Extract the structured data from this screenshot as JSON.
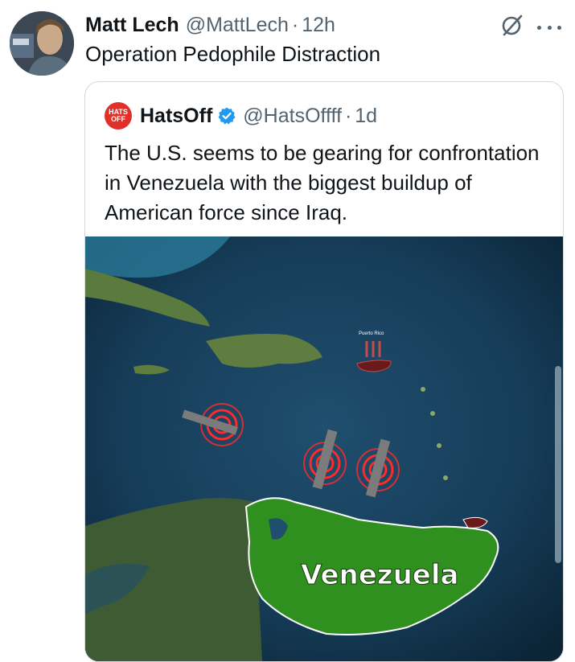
{
  "tweet": {
    "author_name": "Matt Lech",
    "author_handle": "@MattLech",
    "separator": "·",
    "time": "12h",
    "text": "Operation Pedophile Distraction"
  },
  "quoted_tweet": {
    "avatar_text_top": "HATS",
    "avatar_text_bottom": "OFF",
    "author_name": "HatsOff",
    "author_handle": "@HatsOffff",
    "separator": "·",
    "time": "1d",
    "text": "The U.S. seems to be gearing for confrontation in Venezuela with the biggest buildup of American force since Iraq.",
    "media": {
      "label_main": "Venezuela",
      "label_small": "Puerto Rico"
    }
  },
  "icons": {
    "avatar": "user-avatar",
    "grok": "grok-icon",
    "more": "more-options-icon",
    "verified": "verified-badge-icon"
  },
  "colors": {
    "accent_blue": "#1d9bf0",
    "ring_red": "#ff2a2a",
    "land_green": "#2f8f1f"
  }
}
